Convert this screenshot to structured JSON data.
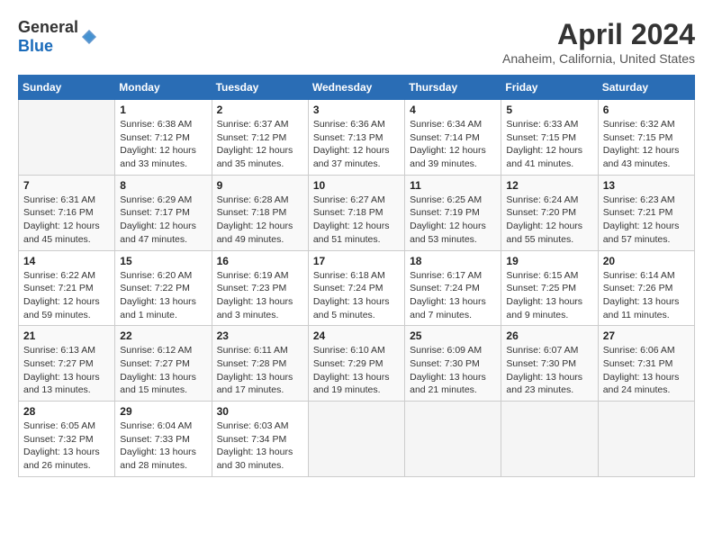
{
  "header": {
    "logo_general": "General",
    "logo_blue": "Blue",
    "title": "April 2024",
    "subtitle": "Anaheim, California, United States"
  },
  "calendar": {
    "days_of_week": [
      "Sunday",
      "Monday",
      "Tuesday",
      "Wednesday",
      "Thursday",
      "Friday",
      "Saturday"
    ],
    "weeks": [
      [
        {
          "day": "",
          "info": ""
        },
        {
          "day": "1",
          "info": "Sunrise: 6:38 AM\nSunset: 7:12 PM\nDaylight: 12 hours\nand 33 minutes."
        },
        {
          "day": "2",
          "info": "Sunrise: 6:37 AM\nSunset: 7:12 PM\nDaylight: 12 hours\nand 35 minutes."
        },
        {
          "day": "3",
          "info": "Sunrise: 6:36 AM\nSunset: 7:13 PM\nDaylight: 12 hours\nand 37 minutes."
        },
        {
          "day": "4",
          "info": "Sunrise: 6:34 AM\nSunset: 7:14 PM\nDaylight: 12 hours\nand 39 minutes."
        },
        {
          "day": "5",
          "info": "Sunrise: 6:33 AM\nSunset: 7:15 PM\nDaylight: 12 hours\nand 41 minutes."
        },
        {
          "day": "6",
          "info": "Sunrise: 6:32 AM\nSunset: 7:15 PM\nDaylight: 12 hours\nand 43 minutes."
        }
      ],
      [
        {
          "day": "7",
          "info": "Sunrise: 6:31 AM\nSunset: 7:16 PM\nDaylight: 12 hours\nand 45 minutes."
        },
        {
          "day": "8",
          "info": "Sunrise: 6:29 AM\nSunset: 7:17 PM\nDaylight: 12 hours\nand 47 minutes."
        },
        {
          "day": "9",
          "info": "Sunrise: 6:28 AM\nSunset: 7:18 PM\nDaylight: 12 hours\nand 49 minutes."
        },
        {
          "day": "10",
          "info": "Sunrise: 6:27 AM\nSunset: 7:18 PM\nDaylight: 12 hours\nand 51 minutes."
        },
        {
          "day": "11",
          "info": "Sunrise: 6:25 AM\nSunset: 7:19 PM\nDaylight: 12 hours\nand 53 minutes."
        },
        {
          "day": "12",
          "info": "Sunrise: 6:24 AM\nSunset: 7:20 PM\nDaylight: 12 hours\nand 55 minutes."
        },
        {
          "day": "13",
          "info": "Sunrise: 6:23 AM\nSunset: 7:21 PM\nDaylight: 12 hours\nand 57 minutes."
        }
      ],
      [
        {
          "day": "14",
          "info": "Sunrise: 6:22 AM\nSunset: 7:21 PM\nDaylight: 12 hours\nand 59 minutes."
        },
        {
          "day": "15",
          "info": "Sunrise: 6:20 AM\nSunset: 7:22 PM\nDaylight: 13 hours\nand 1 minute."
        },
        {
          "day": "16",
          "info": "Sunrise: 6:19 AM\nSunset: 7:23 PM\nDaylight: 13 hours\nand 3 minutes."
        },
        {
          "day": "17",
          "info": "Sunrise: 6:18 AM\nSunset: 7:24 PM\nDaylight: 13 hours\nand 5 minutes."
        },
        {
          "day": "18",
          "info": "Sunrise: 6:17 AM\nSunset: 7:24 PM\nDaylight: 13 hours\nand 7 minutes."
        },
        {
          "day": "19",
          "info": "Sunrise: 6:15 AM\nSunset: 7:25 PM\nDaylight: 13 hours\nand 9 minutes."
        },
        {
          "day": "20",
          "info": "Sunrise: 6:14 AM\nSunset: 7:26 PM\nDaylight: 13 hours\nand 11 minutes."
        }
      ],
      [
        {
          "day": "21",
          "info": "Sunrise: 6:13 AM\nSunset: 7:27 PM\nDaylight: 13 hours\nand 13 minutes."
        },
        {
          "day": "22",
          "info": "Sunrise: 6:12 AM\nSunset: 7:27 PM\nDaylight: 13 hours\nand 15 minutes."
        },
        {
          "day": "23",
          "info": "Sunrise: 6:11 AM\nSunset: 7:28 PM\nDaylight: 13 hours\nand 17 minutes."
        },
        {
          "day": "24",
          "info": "Sunrise: 6:10 AM\nSunset: 7:29 PM\nDaylight: 13 hours\nand 19 minutes."
        },
        {
          "day": "25",
          "info": "Sunrise: 6:09 AM\nSunset: 7:30 PM\nDaylight: 13 hours\nand 21 minutes."
        },
        {
          "day": "26",
          "info": "Sunrise: 6:07 AM\nSunset: 7:30 PM\nDaylight: 13 hours\nand 23 minutes."
        },
        {
          "day": "27",
          "info": "Sunrise: 6:06 AM\nSunset: 7:31 PM\nDaylight: 13 hours\nand 24 minutes."
        }
      ],
      [
        {
          "day": "28",
          "info": "Sunrise: 6:05 AM\nSunset: 7:32 PM\nDaylight: 13 hours\nand 26 minutes."
        },
        {
          "day": "29",
          "info": "Sunrise: 6:04 AM\nSunset: 7:33 PM\nDaylight: 13 hours\nand 28 minutes."
        },
        {
          "day": "30",
          "info": "Sunrise: 6:03 AM\nSunset: 7:34 PM\nDaylight: 13 hours\nand 30 minutes."
        },
        {
          "day": "",
          "info": ""
        },
        {
          "day": "",
          "info": ""
        },
        {
          "day": "",
          "info": ""
        },
        {
          "day": "",
          "info": ""
        }
      ]
    ]
  }
}
